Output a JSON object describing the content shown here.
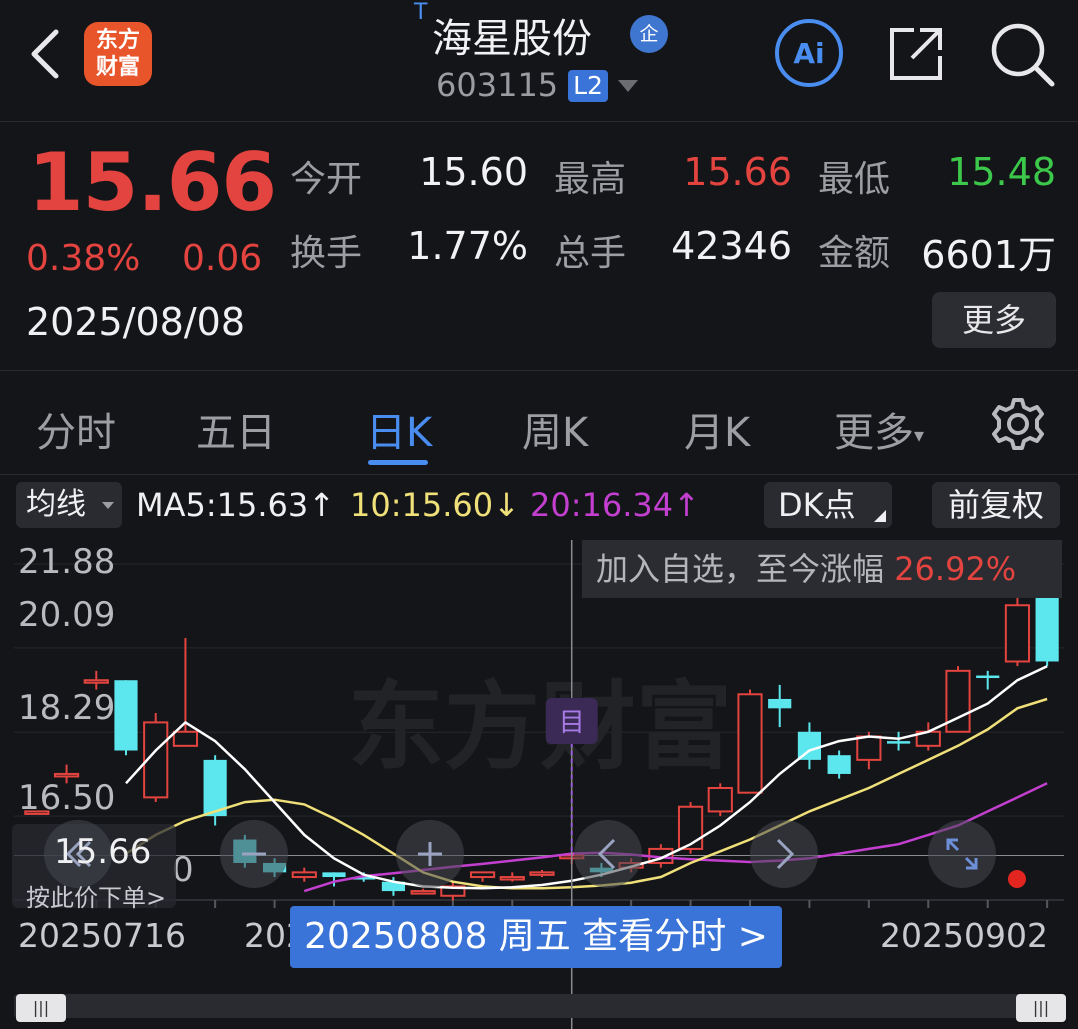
{
  "header": {
    "logo_line1": "东方",
    "logo_line2": "财富",
    "t_mark": "T",
    "title": "海星股份",
    "zheng_badge": "企",
    "code": "603115",
    "level_badge": "L2"
  },
  "quote": {
    "price": "15.66",
    "change_pct": "0.38%",
    "change": "0.06",
    "date": "2025/08/08",
    "fields": [
      {
        "label": "今开",
        "value": "15.60",
        "color": "#f2f2f4"
      },
      {
        "label": "最高",
        "value": "15.66",
        "color": "#e3443f"
      },
      {
        "label": "最低",
        "value": "15.48",
        "color": "#3cc84a"
      },
      {
        "label": "换手",
        "value": "1.77%",
        "color": "#f2f2f4"
      },
      {
        "label": "总手",
        "value": "42346",
        "color": "#f2f2f4"
      },
      {
        "label": "金额",
        "value": "6601万",
        "color": "#f2f2f4"
      }
    ],
    "more_label": "更多"
  },
  "tabs": [
    "分时",
    "五日",
    "日K",
    "周K",
    "月K",
    "更多"
  ],
  "active_tab": "日K",
  "indicator_bar": {
    "selector": "均线",
    "ma5": "MA5:15.63↑",
    "ma10": "10:15.60↓",
    "ma20": "20:16.34↑",
    "dk_label": "DK点",
    "fq_label": "前复权"
  },
  "chart": {
    "tip_text": "加入自选，至今涨幅",
    "tip_value": "26.92%",
    "y_labels": [
      "21.88",
      "20.09",
      "18.29",
      "16.50"
    ],
    "y_label_extra": "0",
    "cursor_badge": "目",
    "x_labels": [
      "20250716",
      "202",
      "20250902"
    ],
    "order_price": "15.66",
    "order_text": "按此价下单>",
    "bottom_bar": "20250808 周五 查看分时 >",
    "watermark": "东方财富",
    "colors": {
      "up": "#e3443f",
      "down": "#5ce6ee",
      "ma5": "#ffffff",
      "ma10": "#f0e07a",
      "ma20": "#c33fd0"
    }
  },
  "chart_data": {
    "type": "candlestick",
    "ylim": [
      14.71,
      21.88
    ],
    "y_ticks": [
      21.88,
      20.09,
      18.29,
      16.5
    ],
    "candles": [
      {
        "o": 16.6,
        "c": 16.6,
        "h": 16.6,
        "l": 16.6,
        "up": true
      },
      {
        "o": 17.4,
        "c": 17.4,
        "h": 17.6,
        "l": 17.2,
        "up": true
      },
      {
        "o": 19.4,
        "c": 19.4,
        "h": 19.6,
        "l": 19.2,
        "up": true
      },
      {
        "o": 19.4,
        "c": 17.9,
        "h": 19.4,
        "l": 17.8,
        "up": false
      },
      {
        "o": 16.9,
        "c": 18.5,
        "h": 18.7,
        "l": 16.8,
        "up": true
      },
      {
        "o": 18.0,
        "c": 18.3,
        "h": 20.3,
        "l": 18.0,
        "up": true
      },
      {
        "o": 17.7,
        "c": 16.5,
        "h": 17.8,
        "l": 16.3,
        "up": false
      },
      {
        "o": 16.0,
        "c": 15.5,
        "h": 16.1,
        "l": 15.4,
        "up": false
      },
      {
        "o": 15.5,
        "c": 15.3,
        "h": 15.6,
        "l": 15.2,
        "up": false
      },
      {
        "o": 15.2,
        "c": 15.3,
        "h": 15.4,
        "l": 15.1,
        "up": true
      },
      {
        "o": 15.3,
        "c": 15.2,
        "h": 15.3,
        "l": 15.0,
        "up": false
      },
      {
        "o": 15.2,
        "c": 15.2,
        "h": 15.3,
        "l": 15.1,
        "up": false
      },
      {
        "o": 15.1,
        "c": 14.9,
        "h": 15.2,
        "l": 14.8,
        "up": false
      },
      {
        "o": 14.9,
        "c": 14.9,
        "h": 14.95,
        "l": 14.85,
        "up": true
      },
      {
        "o": 14.8,
        "c": 15.0,
        "h": 15.1,
        "l": 14.7,
        "up": true
      },
      {
        "o": 15.2,
        "c": 15.3,
        "h": 15.3,
        "l": 15.1,
        "up": true
      },
      {
        "o": 15.2,
        "c": 15.2,
        "h": 15.3,
        "l": 15.1,
        "up": true
      },
      {
        "o": 15.3,
        "c": 15.3,
        "h": 15.35,
        "l": 15.2,
        "up": true
      },
      {
        "o": 15.6,
        "c": 15.66,
        "h": 15.66,
        "l": 15.48,
        "up": true
      },
      {
        "o": 15.4,
        "c": 15.3,
        "h": 15.5,
        "l": 15.2,
        "up": false
      },
      {
        "o": 15.4,
        "c": 15.5,
        "h": 15.6,
        "l": 15.3,
        "up": true
      },
      {
        "o": 15.5,
        "c": 15.8,
        "h": 15.9,
        "l": 15.4,
        "up": true
      },
      {
        "o": 15.8,
        "c": 16.7,
        "h": 16.8,
        "l": 15.7,
        "up": true
      },
      {
        "o": 16.6,
        "c": 17.1,
        "h": 17.2,
        "l": 16.5,
        "up": true
      },
      {
        "o": 17.0,
        "c": 19.1,
        "h": 19.2,
        "l": 17.0,
        "up": true
      },
      {
        "o": 19.0,
        "c": 18.8,
        "h": 19.3,
        "l": 18.4,
        "up": false
      },
      {
        "o": 18.3,
        "c": 17.7,
        "h": 18.5,
        "l": 17.5,
        "up": false
      },
      {
        "o": 17.8,
        "c": 17.4,
        "h": 17.9,
        "l": 17.3,
        "up": false
      },
      {
        "o": 17.7,
        "c": 18.2,
        "h": 18.3,
        "l": 17.5,
        "up": true
      },
      {
        "o": 18.1,
        "c": 18.1,
        "h": 18.3,
        "l": 17.9,
        "up": false
      },
      {
        "o": 18.0,
        "c": 18.3,
        "h": 18.5,
        "l": 17.9,
        "up": true
      },
      {
        "o": 18.3,
        "c": 19.6,
        "h": 19.7,
        "l": 18.3,
        "up": true
      },
      {
        "o": 19.5,
        "c": 19.5,
        "h": 19.6,
        "l": 19.2,
        "up": false
      },
      {
        "o": 19.8,
        "c": 21.0,
        "h": 21.8,
        "l": 19.7,
        "up": true
      },
      {
        "o": 21.2,
        "c": 19.8,
        "h": 21.5,
        "l": 19.7,
        "up": false
      }
    ],
    "ma5": [
      17.2,
      17.9,
      18.5,
      18.1,
      17.5,
      16.8,
      16.1,
      15.6,
      15.25,
      15.1,
      15.0,
      14.97,
      14.96,
      14.98,
      15.03,
      15.12,
      15.25,
      15.42,
      15.6,
      15.9,
      16.3,
      16.8,
      17.4,
      17.9,
      18.1,
      18.2,
      18.15,
      18.3,
      18.6,
      18.9,
      19.4,
      19.7
    ],
    "ma10": [
      15.7,
      16.1,
      16.4,
      16.6,
      16.8,
      16.85,
      16.75,
      16.45,
      16.1,
      15.7,
      15.3,
      15.1,
      15.0,
      14.96,
      14.96,
      14.98,
      15.02,
      15.08,
      15.2,
      15.5,
      15.75,
      16.0,
      16.3,
      16.6,
      16.85,
      17.1,
      17.4,
      17.7,
      18.0,
      18.35,
      18.8,
      19.0
    ],
    "ma20": [
      14.9,
      15.1,
      15.22,
      15.28,
      15.35,
      15.42,
      15.48,
      15.55,
      15.62,
      15.7,
      15.72,
      15.68,
      15.62,
      15.58,
      15.55,
      15.52,
      15.55,
      15.6,
      15.7,
      15.8,
      15.9,
      16.1,
      16.3,
      16.6,
      16.9,
      17.2
    ],
    "cursor_index": 18
  }
}
